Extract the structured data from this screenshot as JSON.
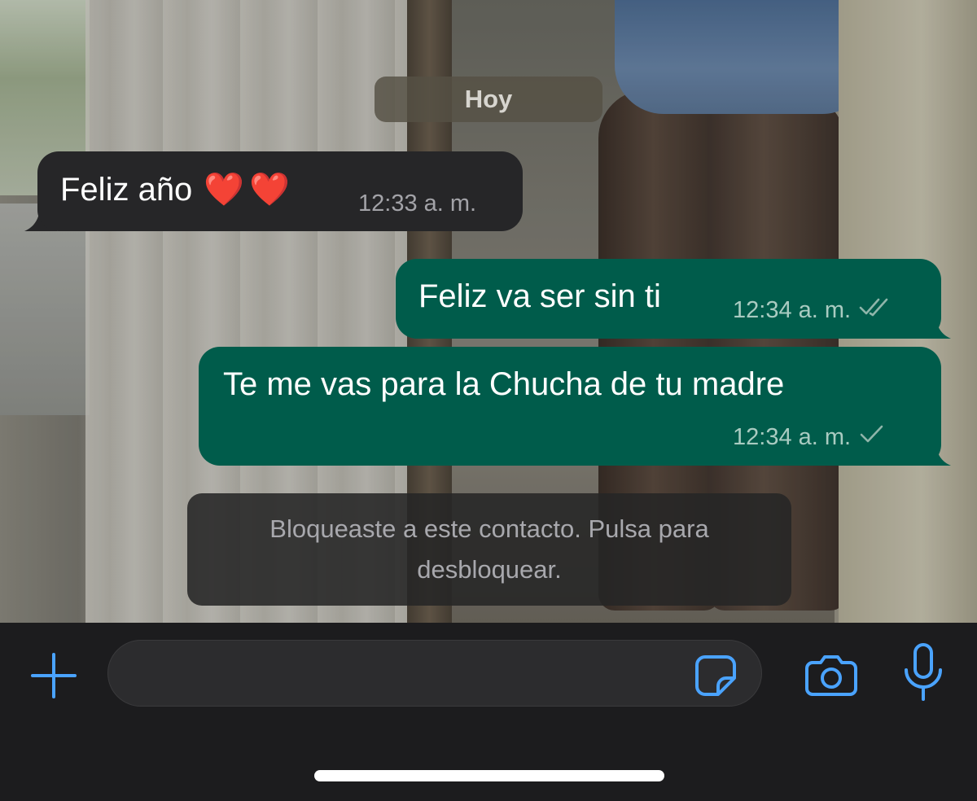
{
  "chat": {
    "date_label": "Hoy",
    "messages": [
      {
        "direction": "incoming",
        "text": "Feliz año",
        "emoji": "❤️❤️",
        "time": "12:33 a. m."
      },
      {
        "direction": "outgoing",
        "text": "Feliz va ser sin ti",
        "time": "12:34 a. m.",
        "status_icon": "double-check-icon"
      },
      {
        "direction": "outgoing",
        "text": "Te me vas para la Chucha de tu madre",
        "time": "12:34 a. m.",
        "status_icon": "single-check-icon"
      }
    ],
    "system_notice": "Bloqueaste a este contacto. Pulsa para desbloquear."
  },
  "input_bar": {
    "icons": [
      "plus-icon",
      "sticker-icon",
      "camera-icon",
      "microphone-icon"
    ],
    "accent_color": "#4aa3ff"
  },
  "colors": {
    "incoming_bubble": "#262628",
    "outgoing_bubble": "#005c4b",
    "input_bar_bg": "#1c1c1e"
  }
}
